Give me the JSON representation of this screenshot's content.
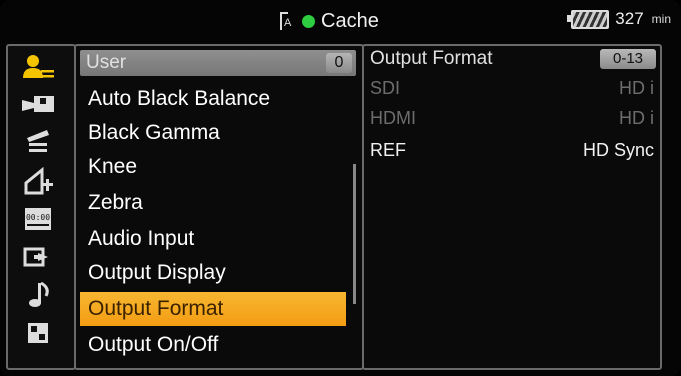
{
  "status_bar": {
    "card_mark": "A",
    "cache_label": "Cache",
    "cache_color": "#2ecc40",
    "battery_value": "327",
    "battery_unit": "min"
  },
  "sidebar": {
    "icons": [
      "user-icon",
      "camera-icon",
      "clapper-icon",
      "ramp-icon",
      "timecode-icon",
      "output-icon",
      "note-icon",
      "grid-icon"
    ]
  },
  "menu": {
    "header_label": "User",
    "header_number": "0",
    "items": [
      {
        "label": "Auto Black Balance"
      },
      {
        "label": "Black Gamma"
      },
      {
        "label": "Knee"
      },
      {
        "label": "Zebra"
      },
      {
        "label": "Audio Input"
      },
      {
        "label": "Output Display"
      },
      {
        "label": "Output Format"
      },
      {
        "label": "Output On/Off"
      }
    ],
    "selected_index": 6,
    "selected_color": "#f39c12"
  },
  "detail": {
    "title": "Output Format",
    "badge": "0-13",
    "rows": [
      {
        "key": "SDI",
        "value": "HD i",
        "enabled": false
      },
      {
        "key": "HDMI",
        "value": "HD i",
        "enabled": false
      },
      {
        "key": "REF",
        "value": "HD Sync",
        "enabled": true
      }
    ]
  }
}
